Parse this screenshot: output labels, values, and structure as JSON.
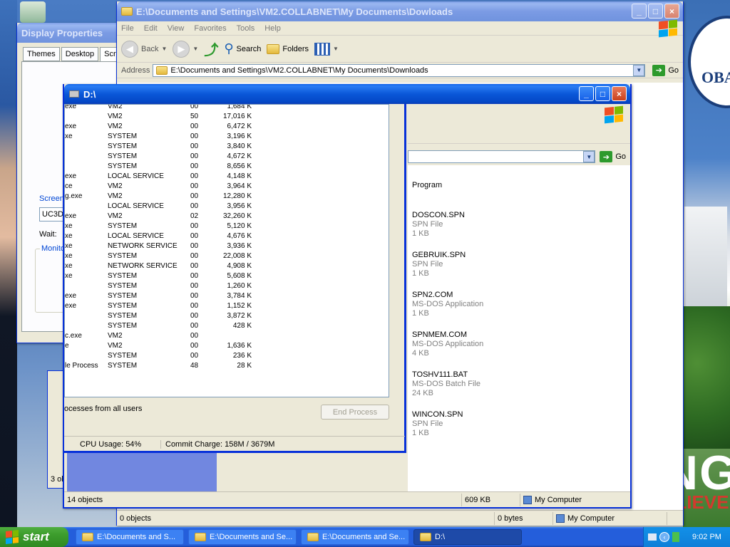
{
  "desktop": {
    "wallpaper_text_top": "OBA",
    "wallpaper_text_bottom": "NG",
    "wallpaper_text_bottom2": "ELIEVE"
  },
  "display_properties": {
    "title": "Display Properties",
    "tabs": [
      "Themes",
      "Desktop",
      "Scre"
    ],
    "screensaver_label": "Screen",
    "screensaver_value": "UC3D",
    "wait_label": "Wait:",
    "monitor_label": "Monito"
  },
  "explorer_back": {
    "title": "E:\\Documents and Settings\\VM2.COLLABNET\\My Documents\\Dowloads",
    "menu": [
      "File",
      "Edit",
      "View",
      "Favorites",
      "Tools",
      "Help"
    ],
    "toolbar": {
      "back": "Back",
      "search": "Search",
      "folders": "Folders"
    },
    "address_label": "Address",
    "address_value": "E:\\Documents and Settings\\VM2.COLLABNET\\My Documents\\Downloads",
    "go_label": "Go",
    "status_left": "0 objects",
    "status_size": "0 bytes",
    "status_location": "My Computer",
    "partial_status": "3 ol"
  },
  "explorer_d": {
    "title": "D:\\",
    "go_label": "Go",
    "column_header": "Program",
    "files": [
      {
        "name": "DOSCON.SPN",
        "type": "SPN File",
        "size": "1 KB"
      },
      {
        "name": "GEBRUIK.SPN",
        "type": "SPN File",
        "size": "1 KB"
      },
      {
        "name": "SPN2.COM",
        "type": "MS-DOS Application",
        "size": "1 KB"
      },
      {
        "name": "SPNMEM.COM",
        "type": "MS-DOS Application",
        "size": "4 KB"
      },
      {
        "name": "TOSHV111.BAT",
        "type": "MS-DOS Batch File",
        "size": "24 KB"
      },
      {
        "name": "WINCON.SPN",
        "type": "SPN File",
        "size": "1 KB"
      }
    ],
    "status_count": "14 objects",
    "status_size": "609 KB",
    "status_location": "My Computer"
  },
  "task_manager": {
    "processes": [
      {
        "name": "exe",
        "user": "VM2",
        "cpu": "00",
        "mem": "1,684 K"
      },
      {
        "name": "",
        "user": "VM2",
        "cpu": "50",
        "mem": "17,016 K"
      },
      {
        "name": "exe",
        "user": "VM2",
        "cpu": "00",
        "mem": "6,472 K"
      },
      {
        "name": "xe",
        "user": "SYSTEM",
        "cpu": "00",
        "mem": "3,196 K"
      },
      {
        "name": "",
        "user": "SYSTEM",
        "cpu": "00",
        "mem": "3,840 K"
      },
      {
        "name": "",
        "user": "SYSTEM",
        "cpu": "00",
        "mem": "4,672 K"
      },
      {
        "name": "",
        "user": "SYSTEM",
        "cpu": "00",
        "mem": "8,656 K"
      },
      {
        "name": "exe",
        "user": "LOCAL SERVICE",
        "cpu": "00",
        "mem": "4,148 K"
      },
      {
        "name": "ce",
        "user": "VM2",
        "cpu": "00",
        "mem": "3,964 K"
      },
      {
        "name": "g.exe",
        "user": "VM2",
        "cpu": "00",
        "mem": "12,280 K"
      },
      {
        "name": "",
        "user": "LOCAL SERVICE",
        "cpu": "00",
        "mem": "3,956 K"
      },
      {
        "name": "exe",
        "user": "VM2",
        "cpu": "02",
        "mem": "32,260 K"
      },
      {
        "name": "xe",
        "user": "SYSTEM",
        "cpu": "00",
        "mem": "5,120 K"
      },
      {
        "name": "xe",
        "user": "LOCAL SERVICE",
        "cpu": "00",
        "mem": "4,676 K"
      },
      {
        "name": "xe",
        "user": "NETWORK SERVICE",
        "cpu": "00",
        "mem": "3,936 K"
      },
      {
        "name": "xe",
        "user": "SYSTEM",
        "cpu": "00",
        "mem": "22,008 K"
      },
      {
        "name": "xe",
        "user": "NETWORK SERVICE",
        "cpu": "00",
        "mem": "4,908 K"
      },
      {
        "name": "xe",
        "user": "SYSTEM",
        "cpu": "00",
        "mem": "5,608 K"
      },
      {
        "name": "",
        "user": "SYSTEM",
        "cpu": "00",
        "mem": "1,260 K"
      },
      {
        "name": "exe",
        "user": "SYSTEM",
        "cpu": "00",
        "mem": "3,784 K"
      },
      {
        "name": "exe",
        "user": "SYSTEM",
        "cpu": "00",
        "mem": "1,152 K"
      },
      {
        "name": "",
        "user": "SYSTEM",
        "cpu": "00",
        "mem": "3,872 K"
      },
      {
        "name": "",
        "user": "SYSTEM",
        "cpu": "00",
        "mem": "428 K"
      },
      {
        "name": "c.exe",
        "user": "VM2",
        "cpu": "00",
        "mem": ""
      },
      {
        "name": "e",
        "user": "VM2",
        "cpu": "00",
        "mem": "1,636 K"
      },
      {
        "name": "",
        "user": "SYSTEM",
        "cpu": "00",
        "mem": "236 K"
      },
      {
        "name": "le Process",
        "user": "SYSTEM",
        "cpu": "48",
        "mem": "28 K"
      }
    ],
    "show_all_label": "ocesses from all users",
    "end_process_label": "End Process",
    "cpu_usage": "CPU Usage: 54%",
    "commit_charge": "Commit Charge: 158M / 3679M"
  },
  "taskbar": {
    "start_label": "start",
    "tasks": [
      {
        "label": "E:\\Documents and S..."
      },
      {
        "label": "E:\\Documents and Se..."
      },
      {
        "label": "E:\\Documents and Se..."
      },
      {
        "label": "D:\\"
      }
    ],
    "clock": "9:02 PM"
  },
  "colors": {
    "taskbar_blue": "#245edb",
    "start_green": "#3c9c2c",
    "title_blue": "#0a57d8"
  }
}
